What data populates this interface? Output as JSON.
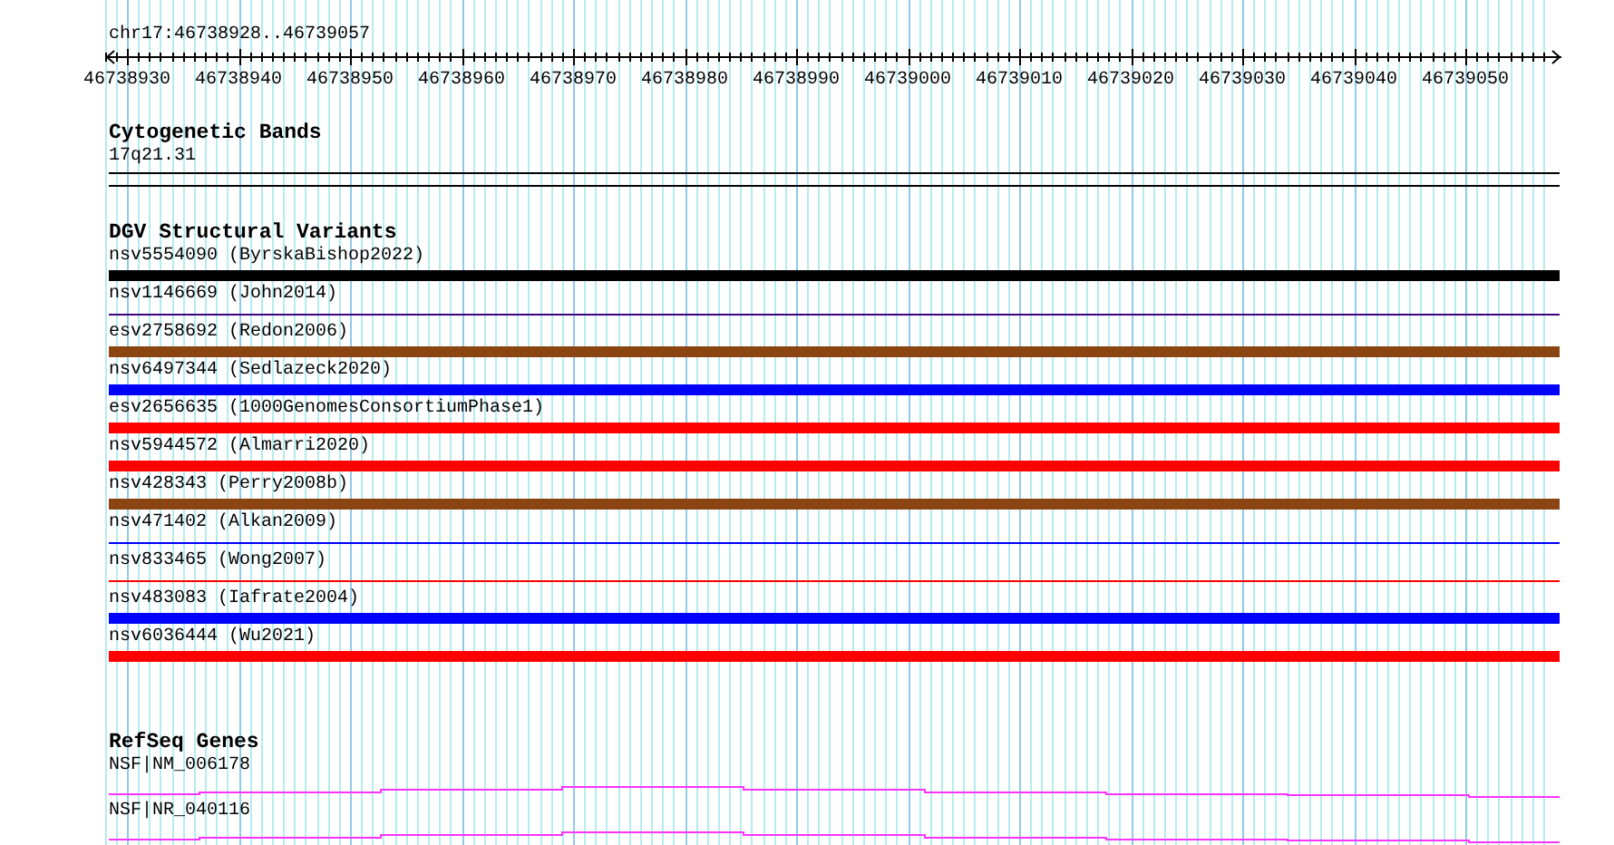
{
  "location": "chr17:46738928..46739057",
  "ruler": {
    "tick_labels": [
      "46738930",
      "46738940",
      "46738950",
      "46738960",
      "46738970",
      "46738980",
      "46738990",
      "46739000",
      "46739010",
      "46739020",
      "46739030",
      "46739040",
      "46739050"
    ]
  },
  "tracks": [
    {
      "kind": "bands",
      "title": "Cytogenetic Bands",
      "features": [
        {
          "label": "17q21.31"
        }
      ]
    },
    {
      "kind": "variants",
      "title": "DGV Structural Variants",
      "features": [
        {
          "label": "nsv5554090 (ByrskaBishop2022)",
          "color": "#000000",
          "kind": "bar"
        },
        {
          "label": "nsv1146669 (John2014)",
          "color": "#400080",
          "kind": "line"
        },
        {
          "label": "esv2758692 (Redon2006)",
          "color": "#8b4513",
          "kind": "bar"
        },
        {
          "label": "nsv6497344 (Sedlazeck2020)",
          "color": "#0000ff",
          "kind": "bar"
        },
        {
          "label": "esv2656635 (1000GenomesConsortiumPhase1)",
          "color": "#ff0000",
          "kind": "bar"
        },
        {
          "label": "nsv5944572 (Almarri2020)",
          "color": "#ff0000",
          "kind": "bar"
        },
        {
          "label": "nsv428343 (Perry2008b)",
          "color": "#8b4513",
          "kind": "bar"
        },
        {
          "label": "nsv471402 (Alkan2009)",
          "color": "#0000ff",
          "kind": "line"
        },
        {
          "label": "nsv833465 (Wong2007)",
          "color": "#ff0000",
          "kind": "line"
        },
        {
          "label": "nsv483083 (Iafrate2004)",
          "color": "#0000ff",
          "kind": "bar"
        },
        {
          "label": "nsv6036444 (Wu2021)",
          "color": "#ff0000",
          "kind": "bar"
        }
      ]
    },
    {
      "kind": "genes",
      "title": "RefSeq Genes",
      "features": [
        {
          "label": "NSF|NM_006178"
        },
        {
          "label": "NSF|NR_040116"
        }
      ]
    }
  ]
}
